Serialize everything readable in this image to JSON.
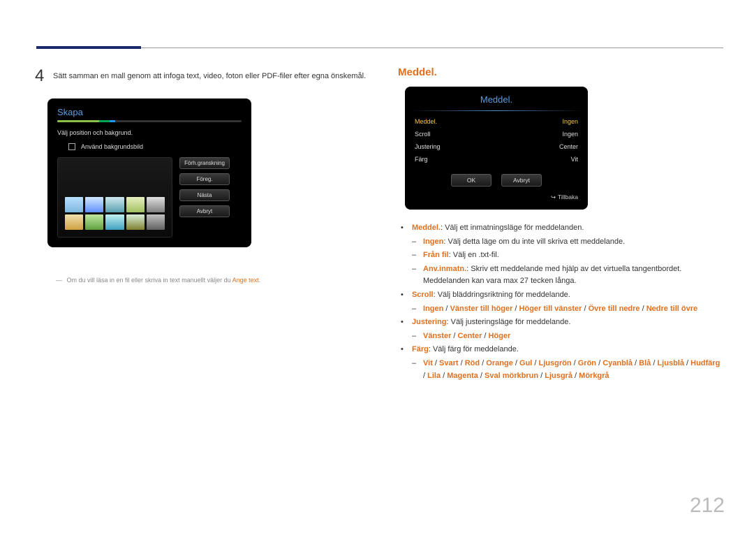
{
  "page_number": "212",
  "left": {
    "step_num": "4",
    "step_text": "Sätt samman en mall genom att infoga text, video, foton eller PDF-filer efter egna önskemål.",
    "panel": {
      "title": "Skapa",
      "subtitle": "Välj position och bakgrund.",
      "checkbox_label": "Använd bakgrundsbild",
      "buttons": {
        "preview": "Förh.granskning",
        "prev": "Föreg.",
        "next": "Nästa",
        "cancel": "Avbryt"
      }
    },
    "footnote_prefix": "Om du vill läsa in en fil eller skriva in text manuellt väljer du ",
    "footnote_action": "Ange text",
    "footnote_suffix": "."
  },
  "right": {
    "heading": "Meddel.",
    "panel": {
      "title": "Meddel.",
      "rows": {
        "r1l": "Meddel.",
        "r1r": "Ingen",
        "r2l": "Scroll",
        "r2r": "Ingen",
        "r3l": "Justering",
        "r3r": "Center",
        "r4l": "Färg",
        "r4r": "Vit"
      },
      "ok": "OK",
      "cancel": "Avbryt",
      "back": "Tillbaka"
    },
    "b1_label": "Meddel.",
    "b1_text": ": Välj ett inmatningsläge för meddelanden.",
    "b1a_label": "Ingen",
    "b1a_text": ": Välj detta läge om du inte vill skriva ett meddelande.",
    "b1b_label": "Från fil",
    "b1b_text": ": Välj en .txt-fil.",
    "b1c_label": "Anv.inmatn.",
    "b1c_text": ": Skriv ett meddelande med hjälp av det virtuella tangentbordet. Meddelanden kan vara max 27 tecken långa.",
    "b2_label": "Scroll",
    "b2_text": ": Välj bläddringsriktning för meddelande.",
    "b2a_opt1": "Ingen",
    "b2a_opt2": "Vänster till höger",
    "b2a_opt3": "Höger till vänster",
    "b2a_opt4": "Övre till nedre",
    "b2a_opt5": "Nedre till övre",
    "b3_label": "Justering",
    "b3_text": ": Välj justeringsläge för meddelande.",
    "b3a_opt1": "Vänster",
    "b3a_opt2": "Center",
    "b3a_opt3": "Höger",
    "b4_label": "Färg",
    "b4_text": ": Välj färg för meddelande.",
    "b4_colors": {
      "c1": "Vit",
      "c2": "Svart",
      "c3": "Röd",
      "c4": "Orange",
      "c5": "Gul",
      "c6": "Ljusgrön",
      "c7": "Grön",
      "c8": "Cyanblå",
      "c9": "Blå",
      "c10": "Ljusblå",
      "c11": "Hudfärg",
      "c12": "Lila",
      "c13": "Magenta",
      "c14": "Sval mörkbrun",
      "c15": "Ljusgrå",
      "c16": "Mörkgrå"
    }
  }
}
